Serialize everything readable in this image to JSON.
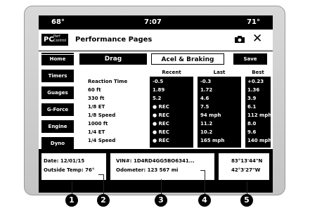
{
  "status": {
    "outside_temp_left": "68°",
    "time": "7:07",
    "temp_right": "71°"
  },
  "header": {
    "logo_main": "PC",
    "logo_sub": "Perf\nControl",
    "title": "Performance Pages",
    "camera_icon": "camera-icon",
    "close_symbol": "✕"
  },
  "sidebar": {
    "items": [
      {
        "label": "Home",
        "active": true
      },
      {
        "label": "Timers"
      },
      {
        "label": "Guages"
      },
      {
        "label": "G-Force"
      },
      {
        "label": "Engine"
      },
      {
        "label": "Dyno"
      }
    ]
  },
  "tabs": {
    "drag": "Drag",
    "accel": "Acel & Braking"
  },
  "save_label": "Save",
  "table": {
    "columns": [
      "Recent",
      "Last",
      "Best"
    ],
    "rows": [
      {
        "label": "Reaction Time",
        "recent": "-0.5",
        "last": "-0.3",
        "best": "+0.23"
      },
      {
        "label": "60 ft",
        "recent": "1.89",
        "last": "1.72",
        "best": "1.36"
      },
      {
        "label": "330 ft",
        "recent": "5.2",
        "last": "4.6",
        "best": "3.9"
      },
      {
        "label": "1/8 ET",
        "recent": "● REC",
        "last": "7.5",
        "best": "6.1"
      },
      {
        "label": "1/8 Speed",
        "recent": "● REC",
        "last": "94 mph",
        "best": "112 mph"
      },
      {
        "label": "1000 ft",
        "recent": "● REC",
        "last": "11.2",
        "best": "8.0"
      },
      {
        "label": "1/4 ET",
        "recent": "● REC",
        "last": "10.2",
        "best": "9.6"
      },
      {
        "label": "1/4 Speed",
        "recent": "● REC",
        "last": "165 mph",
        "best": "140 mph"
      }
    ]
  },
  "footer": {
    "date": "Date: 12/01/15",
    "outside_temp": "Outside Temp: 76°",
    "vin": "VIN#: 1D4RD4GG5BO6341...",
    "odometer": "Odometer: 123 567 mi",
    "lat": "83°13'44\"N",
    "lon": "42°3'27\"W"
  },
  "callouts": [
    "1",
    "2",
    "3",
    "4",
    "5"
  ]
}
